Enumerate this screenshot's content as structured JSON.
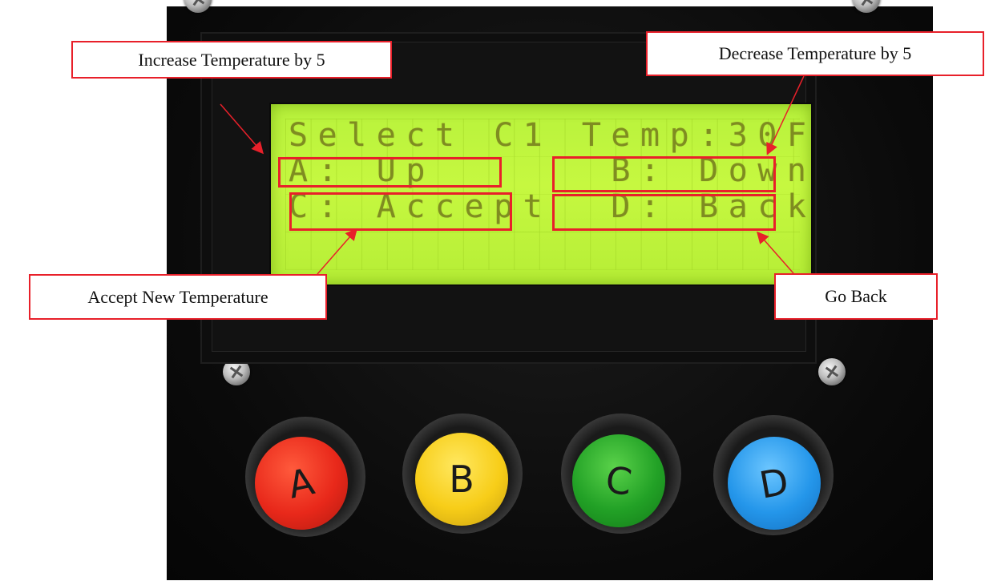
{
  "lcd": {
    "line1": "Select C1 Temp:30F",
    "line2": "A: Up      B: Down",
    "line3": "C: Accept  D: Back"
  },
  "callouts": {
    "increase": "Increase Temperature by 5",
    "decrease": "Decrease Temperature by 5",
    "accept": "Accept New Temperature",
    "back": "Go Back"
  },
  "buttons": {
    "a": "A",
    "b": "B",
    "c": "C",
    "d": "D"
  },
  "colors": {
    "annotation": "#e8202a",
    "lcd_backlight": "#c6f840",
    "button_a": "#e8281a",
    "button_b": "#f7cd18",
    "button_c": "#22a126",
    "button_d": "#2496ea"
  }
}
